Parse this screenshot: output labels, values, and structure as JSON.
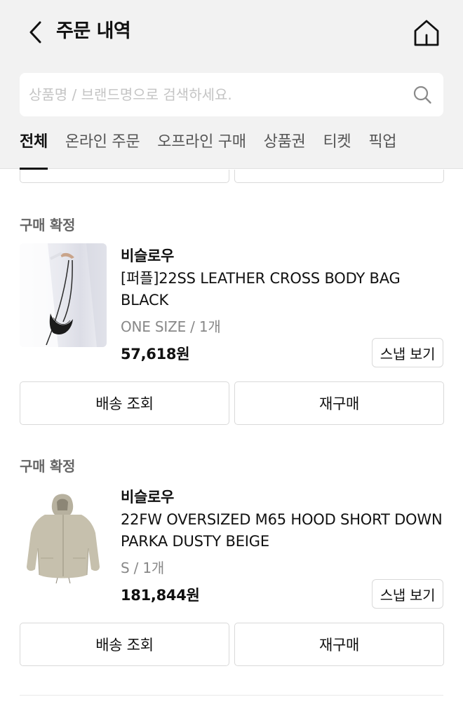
{
  "header": {
    "title": "주문 내역",
    "back_icon": "chevron-left-icon",
    "home_icon": "home-icon"
  },
  "search": {
    "placeholder": "상품명 / 브랜드명으로 검색하세요.",
    "value": "",
    "icon": "search-icon"
  },
  "tabs": [
    {
      "label": "전체",
      "active": true
    },
    {
      "label": "온라인 주문",
      "active": false
    },
    {
      "label": "오프라인 구매",
      "active": false
    },
    {
      "label": "상품권",
      "active": false
    },
    {
      "label": "티켓",
      "active": false
    },
    {
      "label": "픽업",
      "active": false
    }
  ],
  "orders": [
    {
      "status": "구매 확정",
      "brand": "비슬로우",
      "product_name": "[퍼플]22SS LEATHER CROSS BODY BAG BLACK",
      "option": "ONE SIZE / 1개",
      "price": "57,618원",
      "snap_label": "스냅 보기",
      "shipping_label": "배송 조회",
      "reorder_label": "재구매"
    },
    {
      "status": "구매 확정",
      "brand": "비슬로우",
      "product_name": "22FW OVERSIZED M65 HOOD SHORT DOWN PARKA DUSTY BEIGE",
      "option": "S / 1개",
      "price": "181,844원",
      "snap_label": "스냅 보기",
      "shipping_label": "배송 조회",
      "reorder_label": "재구매"
    }
  ],
  "colors": {
    "header_bg": "#f2f2f2",
    "text_primary": "#111111",
    "text_secondary": "#888888",
    "border": "#d9d9d9"
  }
}
